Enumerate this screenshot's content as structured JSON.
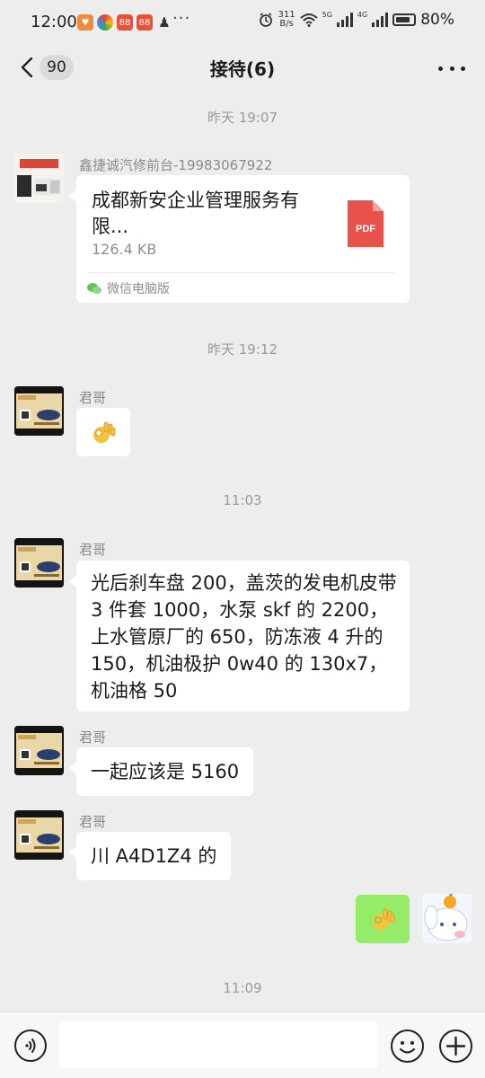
{
  "status_bar": {
    "time": "12:00",
    "more": "···",
    "speed_value": "311",
    "speed_unit": "B/s",
    "net_5g": "5G",
    "net_4g": "4G",
    "battery": "80%"
  },
  "header": {
    "unread_count": "90",
    "title": "接待(6)"
  },
  "messages": {
    "ts1": "昨天 19:07",
    "file_sender": "鑫捷诚汽修前台-19983067922",
    "file_name": "成都新安企业管理服务有限...",
    "file_size": "126.4 KB",
    "file_type": "PDF",
    "file_source": "微信电脑版",
    "ts2": "昨天 19:12",
    "sender_junge": "君哥",
    "ts3": "11:03",
    "msg_parts": "光后刹车盘 200，盖茨的发电机皮带 3 件套 1000，水泵 skf 的 2200，上水管原厂的 650，防冻液 4 升的 150，机油极护 0w40 的 130x7，机油格 50",
    "msg_total": "一起应该是 5160",
    "msg_plate": "川 A4D1Z4 的",
    "ts4": "11:09"
  },
  "colors": {
    "background": "#ededed",
    "self_bubble": "#95ec69",
    "other_bubble": "#ffffff",
    "pdf_red": "#e9524a"
  },
  "icons": [
    "back-icon",
    "more-icon",
    "pdf-icon",
    "ok-hand-icon",
    "voice-icon",
    "emoji-icon",
    "plus-icon"
  ]
}
